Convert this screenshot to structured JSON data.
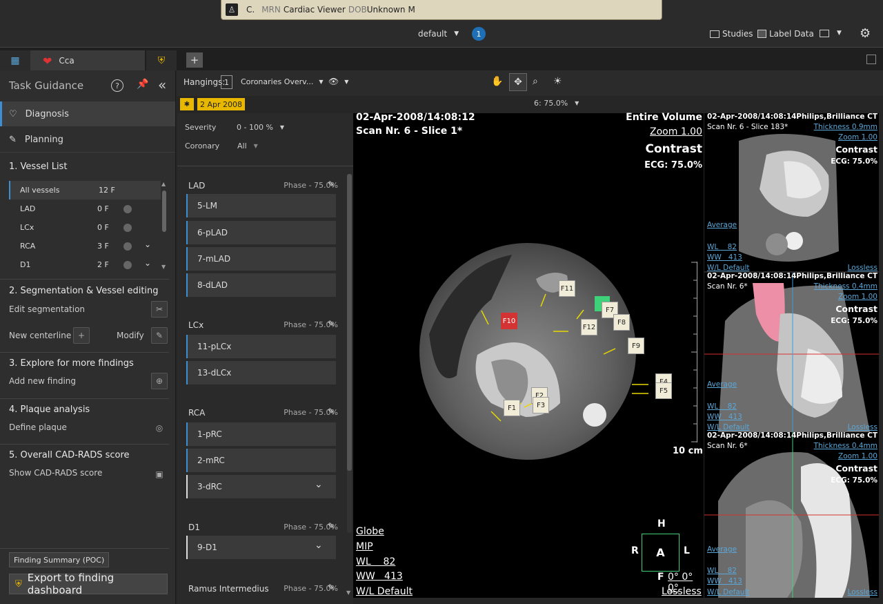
{
  "patient": {
    "initial": "C.",
    "mrn_label": "MRN",
    "mrn_value": "Cardiac Viewer",
    "dob_label": "DOB",
    "dob_value": "Unknown",
    "sex": "M"
  },
  "topbar": {
    "layout": "default",
    "badge": "1",
    "studies": "Studies",
    "label_data": "Label Data"
  },
  "tabs": {
    "active": "Cca",
    "add": "+"
  },
  "task": {
    "title": "Task Guidance",
    "diagnosis": "Diagnosis",
    "planning": "Planning"
  },
  "vessel_list": {
    "title": "1. Vessel List",
    "items": [
      {
        "name": "All vessels",
        "count": "12 F"
      },
      {
        "name": "LAD",
        "count": "0 F"
      },
      {
        "name": "LCx",
        "count": "0 F"
      },
      {
        "name": "RCA",
        "count": "3 F"
      },
      {
        "name": "D1",
        "count": "2 F"
      }
    ]
  },
  "steps": {
    "seg_title": "2. Segmentation & Vessel editing",
    "edit_seg": "Edit segmentation",
    "new_centerline": "New centerline",
    "modify": "Modify",
    "explore_title": "3. Explore for more findings",
    "add_finding": "Add new finding",
    "plaque_title": "4. Plaque analysis",
    "define_plaque": "Define plaque",
    "cadrads_title": "5. Overall CAD-RADS score",
    "show_cadrads": "Show CAD-RADS score"
  },
  "bottom": {
    "summary": "Finding Summary (POC)",
    "export": "Export to finding dashboard"
  },
  "toolbar": {
    "hangings_label": "Hangings:",
    "hangings_num": "1",
    "hanging_value": "Coronaries Overv...",
    "date": "2 Apr 2008",
    "phase_select": "6: 75.0%"
  },
  "filters": {
    "severity_label": "Severity",
    "severity_value": "0 - 100 %",
    "coronary_label": "Coronary",
    "coronary_value": "All"
  },
  "vessel_groups": [
    {
      "name": "LAD",
      "phase": "Phase - 75.0%",
      "segments": [
        "5-LM",
        "6-pLAD",
        "7-mLAD",
        "8-dLAD"
      ]
    },
    {
      "name": "LCx",
      "phase": "Phase - 75.0%",
      "segments": [
        "11-pLCx",
        "13-dLCx"
      ]
    },
    {
      "name": "RCA",
      "phase": "Phase - 75.0%",
      "segments": [
        "1-pRC",
        "2-mRC",
        "3-dRC"
      ]
    },
    {
      "name": "D1",
      "phase": "Phase - 75.0%",
      "segments": [
        "9-D1"
      ]
    },
    {
      "name": "Ramus Intermedius",
      "phase": "Phase - 75.0%",
      "segments": []
    }
  ],
  "main_view": {
    "datetime": "02-Apr-2008/14:08:12",
    "scan": "Scan Nr. 6 - Slice 1*",
    "entire": "Entire Volume",
    "zoom": "Zoom 1.00",
    "contrast": "Contrast",
    "ecg": "ECG: 75.0%",
    "scale": "10 cm",
    "globe": "Globe",
    "mip": "MIP",
    "wl": "WL    82",
    "ww": "WW   413",
    "wl_default": "W/L Default",
    "orient": {
      "top": "H",
      "left": "R",
      "center": "A",
      "right": "L",
      "foot": "F"
    },
    "angle": "0° 0° 0°",
    "lossless": "Lossless",
    "findings": [
      "F11",
      "F10",
      "F12",
      "F7",
      "F8",
      "F9",
      "F4",
      "F5",
      "F2",
      "F3",
      "F1"
    ]
  },
  "side_panels": [
    {
      "datetime": "02-Apr-2008/14:08:14",
      "vendor": "Philips,Brilliance CT",
      "scan": "Scan Nr. 6 - Slice 183*",
      "thickness": "Thickness 0.9mm",
      "zoom": "Zoom 1.00",
      "contrast": "Contrast",
      "ecg": "ECG: 75.0%",
      "average": "Average",
      "wl": "WL    82",
      "ww": "WW   413",
      "wl_default": "W/L Default",
      "lossless": "Lossless"
    },
    {
      "datetime": "02-Apr-2008/14:08:14",
      "vendor": "Philips,Brilliance CT",
      "scan": "Scan Nr. 6*",
      "thickness": "Thickness 0.4mm",
      "zoom": "Zoom 1.00",
      "contrast": "Contrast",
      "ecg": "ECG: 75.0%",
      "average": "Average",
      "wl": "WL    82",
      "ww": "WW   413",
      "wl_default": "W/L Default",
      "lossless": "Lossless"
    },
    {
      "datetime": "02-Apr-2008/14:08:14",
      "vendor": "Philips,Brilliance CT",
      "scan": "Scan Nr. 6*",
      "thickness": "Thickness 0.4mm",
      "zoom": "Zoom 1.00",
      "contrast": "Contrast",
      "ecg": "ECG: 75.0%",
      "average": "Average",
      "wl": "WL    82",
      "ww": "WW   413",
      "wl_default": "W/L Default",
      "lossless": "Lossless"
    }
  ]
}
